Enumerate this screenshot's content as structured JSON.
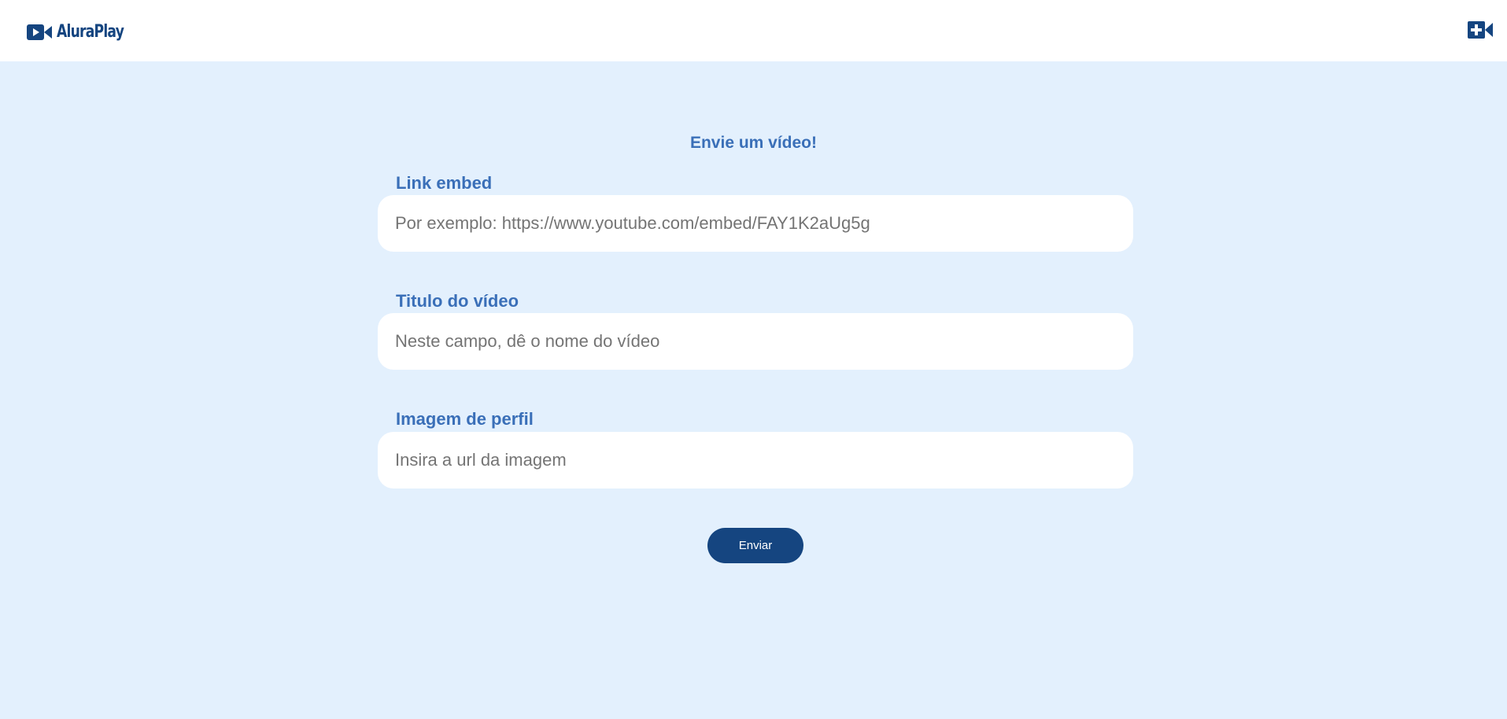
{
  "header": {
    "brand": "AluraPlay",
    "logo_icon": "video-camera-icon",
    "add_icon": "video-camera-plus-icon"
  },
  "form": {
    "title": "Envie um vídeo!",
    "fields": [
      {
        "label": "Link embed",
        "placeholder": "Por exemplo: https://www.youtube.com/embed/FAY1K2aUg5g",
        "value": ""
      },
      {
        "label": "Titulo do vídeo",
        "placeholder": "Neste campo, dê o nome do vídeo",
        "value": ""
      },
      {
        "label": "Imagem de perfil",
        "placeholder": "Insira a url da imagem",
        "value": ""
      }
    ],
    "submit_label": "Enviar"
  },
  "colors": {
    "brand_dark": "#154580",
    "label_blue": "#3a6fb8",
    "background": "#e3f0fd",
    "header_bg": "#ffffff"
  }
}
